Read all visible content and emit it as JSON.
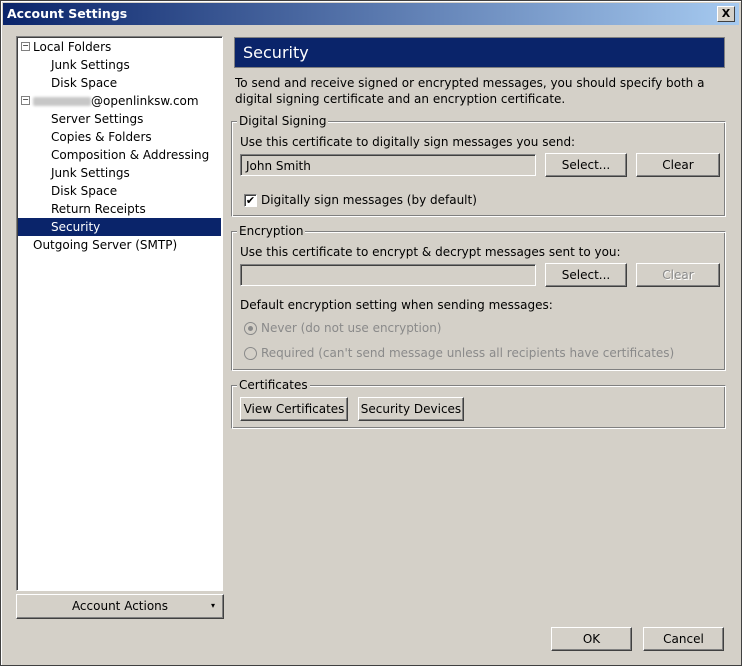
{
  "window": {
    "title": "Account Settings",
    "close_glyph": "X"
  },
  "tree": {
    "items": [
      {
        "label": "Local Folders",
        "toggle": "−"
      },
      {
        "label": "Junk Settings"
      },
      {
        "label": "Disk Space"
      },
      {
        "label": "@openlinksw.com",
        "toggle": "−"
      },
      {
        "label": "Server Settings"
      },
      {
        "label": "Copies & Folders"
      },
      {
        "label": "Composition & Addressing"
      },
      {
        "label": "Junk Settings"
      },
      {
        "label": "Disk Space"
      },
      {
        "label": "Return Receipts"
      },
      {
        "label": "Security"
      },
      {
        "label": "Outgoing Server (SMTP)"
      }
    ],
    "selected": "Security"
  },
  "account_actions": {
    "label": "Account Actions",
    "caret": "▾"
  },
  "panel": {
    "title": "Security",
    "description": "To send and receive signed or encrypted messages, you should specify both a digital signing certificate and an encryption certificate."
  },
  "signing": {
    "legend": "Digital Signing",
    "prompt": "Use this certificate to digitally sign messages you send:",
    "certificate": "John Smith",
    "select_label": "Select...",
    "clear_label": "Clear",
    "sign_checkbox_label": "Digitally sign messages (by default)",
    "sign_checked": true,
    "check_glyph": "✔"
  },
  "encryption": {
    "legend": "Encryption",
    "prompt": "Use this certificate to encrypt & decrypt messages sent to you:",
    "certificate": "",
    "select_label": "Select...",
    "clear_label": "Clear",
    "default_label": "Default encryption setting when sending messages:",
    "never_label": "Never (do not use encryption)",
    "required_label": "Required (can't send message unless all recipients have certificates)"
  },
  "certificates": {
    "legend": "Certificates",
    "view_label": "View Certificates",
    "devices_label": "Security Devices"
  },
  "footer": {
    "ok_label": "OK",
    "cancel_label": "Cancel"
  }
}
